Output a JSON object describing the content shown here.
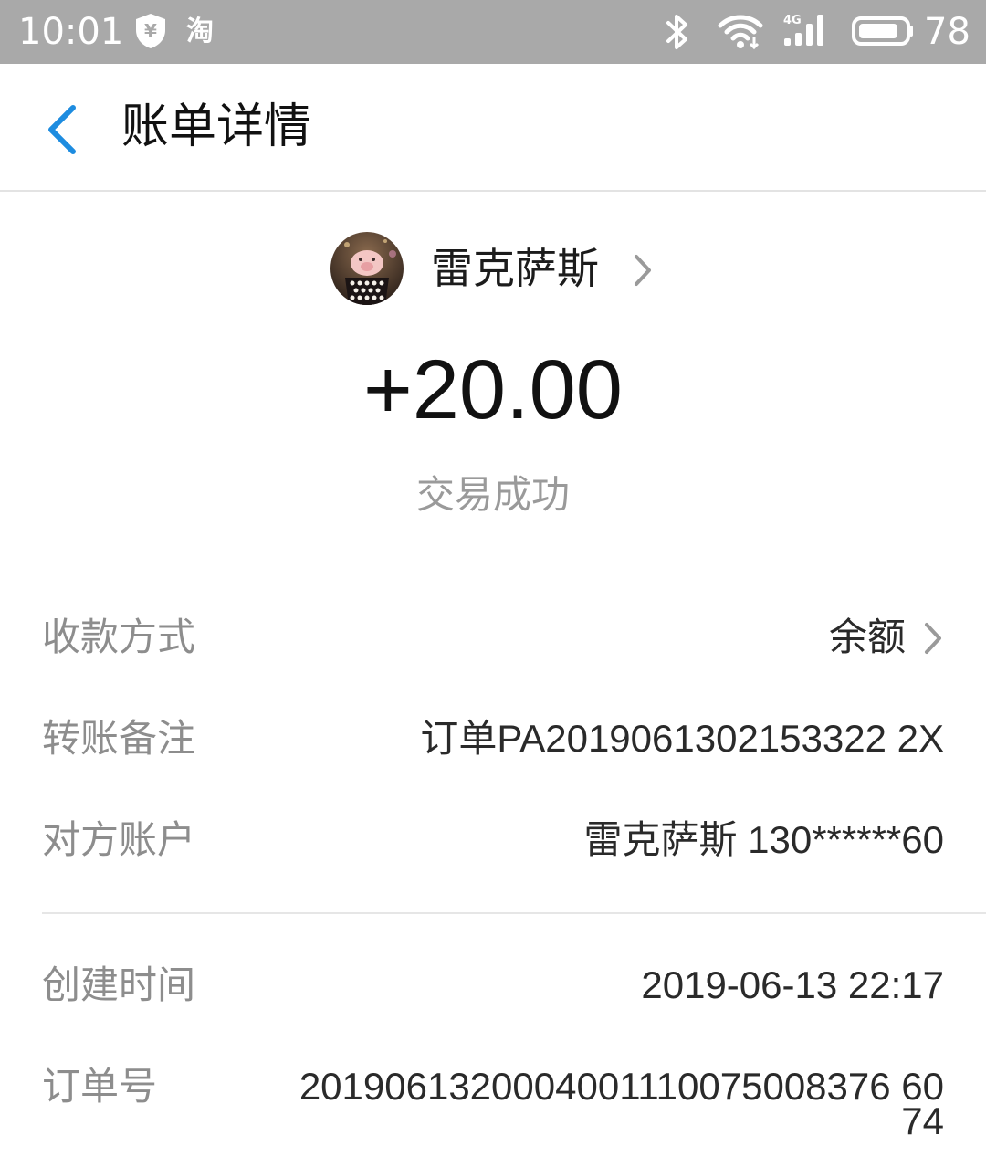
{
  "status_bar": {
    "time": "10:01",
    "shield_icon": "yuan-shield-icon",
    "taobao_label": "淘",
    "bluetooth_icon": "bluetooth-icon",
    "wifi_icon": "wifi-icon",
    "signal_label": "4G",
    "battery_level": "78"
  },
  "header": {
    "title": "账单详情",
    "back_icon": "chevron-left-icon"
  },
  "payer": {
    "name": "雷克萨斯",
    "avatar_icon": "pig-avatar"
  },
  "transaction": {
    "amount": "+20.00",
    "status": "交易成功"
  },
  "details": {
    "method_label": "收款方式",
    "method_value": "余额",
    "remark_label": "转账备注",
    "remark_value": "订单PA2019061302153322 2X",
    "account_label": "对方账户",
    "account_value": "雷克萨斯 130******60",
    "created_label": "创建时间",
    "created_value": "2019-06-13 22:17",
    "order_label": "订单号",
    "order_value_line1": "2019061320004001110075008376 60",
    "order_value_line2": "74"
  },
  "colors": {
    "status_bar_bg": "#a9a9a9",
    "accent_blue": "#1d8ce0",
    "label_gray": "#8d8d8d",
    "value_dark": "#2a2a2a"
  }
}
